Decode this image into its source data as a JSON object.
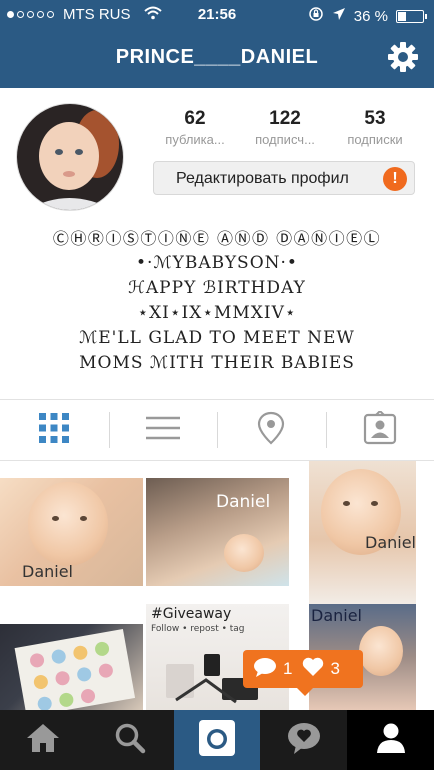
{
  "status_bar": {
    "carrier": "MTS RUS",
    "time": "21:56",
    "battery_percent": "36 %",
    "battery_level": 0.36
  },
  "header": {
    "username": "PRINCE____DANIEL",
    "settings_icon": "gear-icon"
  },
  "profile": {
    "stats": [
      {
        "value": "62",
        "label": "публика..."
      },
      {
        "value": "122",
        "label": "подписч..."
      },
      {
        "value": "53",
        "label": "подписки"
      }
    ],
    "edit_button": "Редактировать профил",
    "warning_badge": "!"
  },
  "bio": {
    "lines": [
      "ⒸⒽⓇⒾⓈⓉⒾⓃⒺ ⒶⓃⒹ ⒹⒶⓃⒾⒺⓁ",
      "•·ℳYBABYSON·•",
      "ℋAPPY ℬIRTHDAY",
      "⋆XI⋆IX⋆MMXIV⋆",
      "ℳE'LL GLAD TO MEET NEW",
      "MOMS ℳITH THEIR BABIES"
    ]
  },
  "view_tabs": [
    {
      "name": "grid-view-tab",
      "icon": "grid-icon",
      "active": true
    },
    {
      "name": "list-view-tab",
      "icon": "list-icon",
      "active": false
    },
    {
      "name": "map-view-tab",
      "icon": "location-pin-icon",
      "active": false
    },
    {
      "name": "tagged-view-tab",
      "icon": "tagged-person-icon",
      "active": false
    }
  ],
  "photos": {
    "captions": [
      "Daniel",
      "Daniel",
      "Daniel",
      "#Giveaway",
      "Follow • repost • tag",
      "Daniel"
    ]
  },
  "activity": {
    "comments": "1",
    "likes": "3"
  },
  "bottom_tabs": [
    "home-icon",
    "search-icon",
    "camera-icon",
    "activity-icon",
    "profile-icon"
  ],
  "colors": {
    "brand_blue": "#2b5a84",
    "grid_blue": "#3d87c4",
    "accent_orange": "#f0731f",
    "tabbar_dark": "#1b1b1b"
  }
}
